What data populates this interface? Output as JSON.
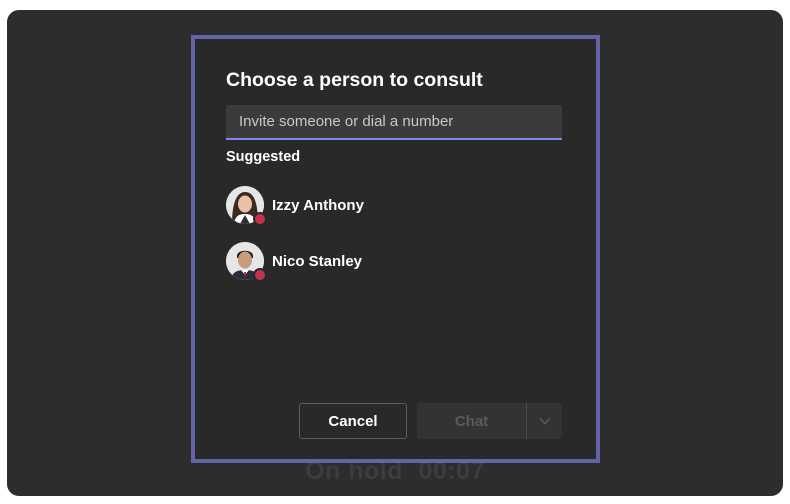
{
  "dialog": {
    "title": "Choose a person to consult",
    "search_placeholder": "Invite someone or dial a number",
    "suggested_label": "Suggested",
    "people": [
      {
        "name": "Izzy Anthony",
        "presence": "busy",
        "avatar": "female-avatar"
      },
      {
        "name": "Nico Stanley",
        "presence": "busy",
        "avatar": "male-avatar"
      }
    ],
    "cancel_label": "Cancel",
    "chat_label": "Chat"
  },
  "call": {
    "status": "On hold",
    "timer": "00:07"
  },
  "colors": {
    "accent": "#6264a7",
    "presence_busy": "#c4314b",
    "background": "#2d2d2d"
  }
}
